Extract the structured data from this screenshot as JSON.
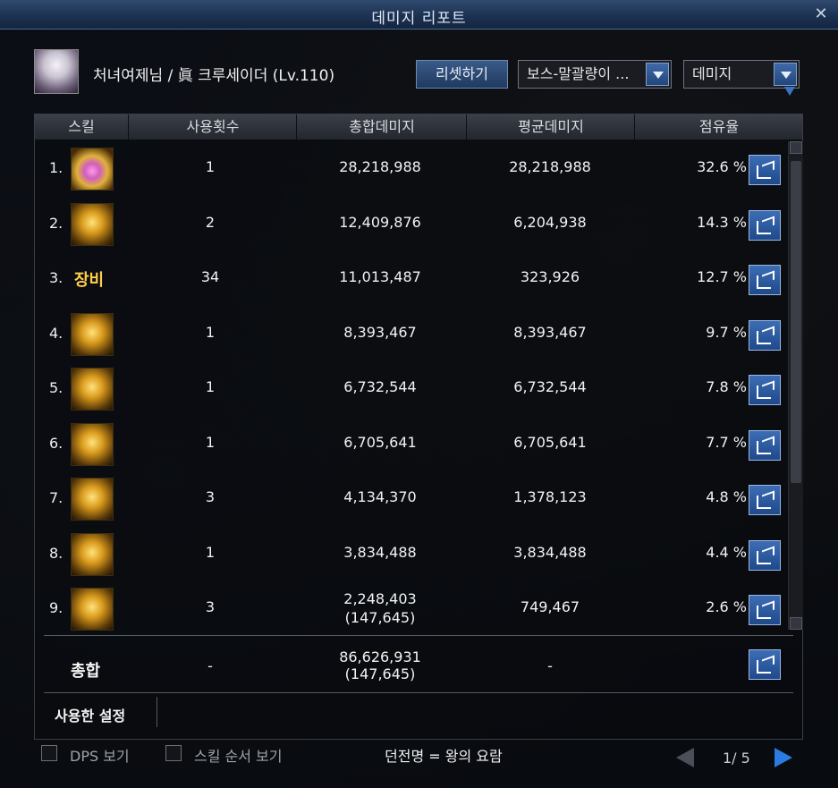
{
  "window": {
    "title": "데미지 리포트"
  },
  "header": {
    "character": "처녀여제님 / 眞 크루세이더 (Lv.110)",
    "reset_label": "리셋하기",
    "boss_select": "보스-말괄량이 ...",
    "metric_select": "데미지"
  },
  "columns": [
    "스킬",
    "사용횟수",
    "총합데미지",
    "평균데미지",
    "점유율"
  ],
  "rows": [
    {
      "idx": "1.",
      "icon": "skill-pink-icon",
      "count": "1",
      "total": "28,218,988",
      "total2": "",
      "avg": "28,218,988",
      "pct": "32.6 %"
    },
    {
      "idx": "2.",
      "icon": "skill-gold-icon",
      "count": "2",
      "total": "12,409,876",
      "total2": "",
      "avg": "6,204,938",
      "pct": "14.3 %"
    },
    {
      "idx": "3.",
      "icon": "equipment-label",
      "label": "장비",
      "count": "34",
      "total": "11,013,487",
      "total2": "",
      "avg": "323,926",
      "pct": "12.7 %"
    },
    {
      "idx": "4.",
      "icon": "skill-gold-icon",
      "count": "1",
      "total": "8,393,467",
      "total2": "",
      "avg": "8,393,467",
      "pct": "9.7 %"
    },
    {
      "idx": "5.",
      "icon": "skill-gold-icon",
      "count": "1",
      "total": "6,732,544",
      "total2": "",
      "avg": "6,732,544",
      "pct": "7.8 %"
    },
    {
      "idx": "6.",
      "icon": "skill-gold-icon",
      "count": "1",
      "total": "6,705,641",
      "total2": "",
      "avg": "6,705,641",
      "pct": "7.7 %"
    },
    {
      "idx": "7.",
      "icon": "skill-gold-icon",
      "count": "3",
      "total": "4,134,370",
      "total2": "",
      "avg": "1,378,123",
      "pct": "4.8 %"
    },
    {
      "idx": "8.",
      "icon": "skill-gold-icon",
      "count": "1",
      "total": "3,834,488",
      "total2": "",
      "avg": "3,834,488",
      "pct": "4.4 %"
    },
    {
      "idx": "9.",
      "icon": "skill-gold-icon",
      "count": "3",
      "total": "2,248,403",
      "total2": "(147,645)",
      "avg": "749,467",
      "pct": "2.6 %"
    }
  ],
  "totals": {
    "label": "총합",
    "count": "-",
    "total": "86,626,931",
    "total2": "(147,645)",
    "avg": "-"
  },
  "used_setting_label": "사용한 설정",
  "footer": {
    "dps_label": "DPS 보기",
    "skill_order_label": "스킬 순서 보기",
    "dungeon": "던전명 = 왕의 요람",
    "page": "1/ 5"
  }
}
